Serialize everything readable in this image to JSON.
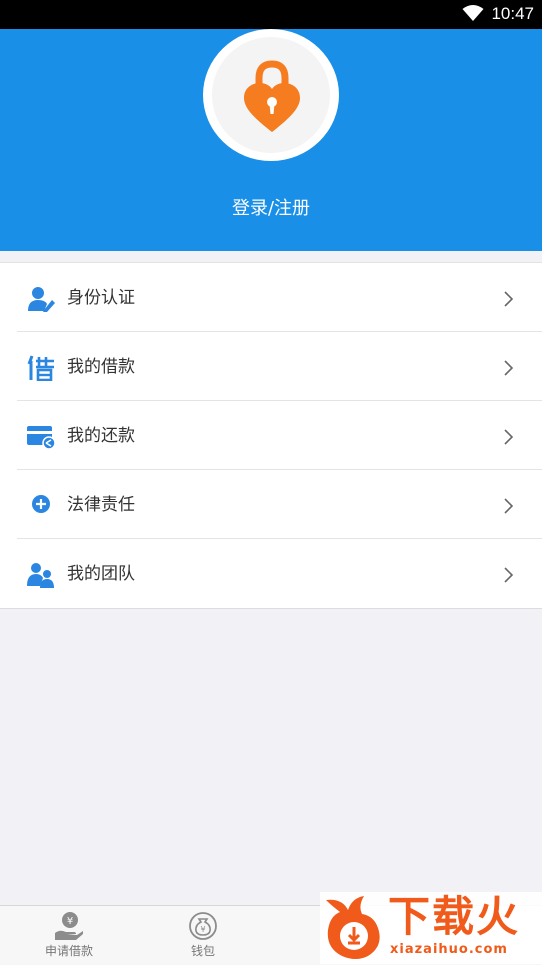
{
  "status_bar": {
    "time": "10:47"
  },
  "header": {
    "login_label": "登录/注册"
  },
  "menu": {
    "items": [
      {
        "label": "身份认证",
        "icon": "identity-verify-icon"
      },
      {
        "label": "我的借款",
        "icon": "borrow-icon"
      },
      {
        "label": "我的还款",
        "icon": "repayment-card-icon"
      },
      {
        "label": "法律责任",
        "icon": "plus-circle-icon"
      },
      {
        "label": "我的团队",
        "icon": "team-icon"
      }
    ]
  },
  "tabbar": {
    "tabs": [
      {
        "label": "申请借款",
        "icon": "apply-loan-icon"
      },
      {
        "label": "钱包",
        "icon": "wallet-icon"
      }
    ]
  },
  "watermark": {
    "title": "下载火",
    "url": "xiazaihuo.com"
  },
  "colors": {
    "header_blue": "#1a8fe8",
    "lock_orange": "#f57c1f",
    "icon_blue": "#2a86e0"
  }
}
